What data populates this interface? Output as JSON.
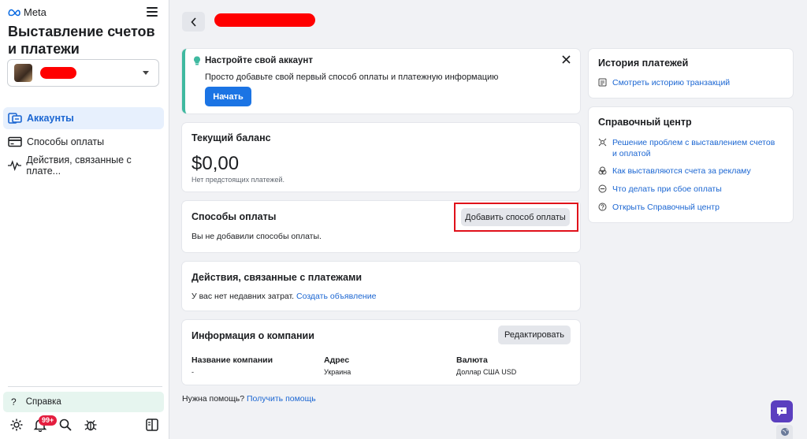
{
  "brand": {
    "name": "Meta"
  },
  "sidebar": {
    "title": "Выставление счетов и платежи",
    "nav": [
      {
        "label": "Аккаунты",
        "icon": "accounts-icon",
        "active": true
      },
      {
        "label": "Способы оплаты",
        "icon": "credit-card-icon",
        "active": false
      },
      {
        "label": "Действия, связанные с плате...",
        "icon": "activity-pulse-icon",
        "active": false
      }
    ],
    "help_label": "Справка",
    "notifications_badge": "99+"
  },
  "setup_banner": {
    "title": "Настройте свой аккаунт",
    "description": "Просто добавьте свой первый способ оплаты и платежную информацию",
    "button_label": "Начать"
  },
  "balance": {
    "title": "Текущий баланс",
    "amount": "$0,00",
    "note": "Нет предстоящих платежей."
  },
  "payment_methods": {
    "title": "Способы оплаты",
    "add_button_label": "Добавить способ оплаты",
    "empty_text": "Вы не добавили способы оплаты."
  },
  "payment_activity": {
    "title": "Действия, связанные с платежами",
    "text": "У вас нет недавних затрат.",
    "link": "Создать объявление"
  },
  "company": {
    "title": "Информация о компании",
    "edit_label": "Редактировать",
    "fields": [
      {
        "label": "Название компании",
        "value": "-"
      },
      {
        "label": "Адрес",
        "value": "Украина"
      },
      {
        "label": "Валюта",
        "value": "Доллар США USD"
      }
    ]
  },
  "footer": {
    "help_text": "Нужна помощь?",
    "help_link": "Получить помощь"
  },
  "payment_history": {
    "title": "История платежей",
    "link": "Смотреть историю транзакций"
  },
  "help_center": {
    "title": "Справочный центр",
    "links": [
      {
        "label": "Решение проблем с выставлением счетов и оплатой",
        "icon": "troubleshoot-icon"
      },
      {
        "label": "Как выставляются счета за рекламу",
        "icon": "billing-info-icon"
      },
      {
        "label": "Что делать при сбое оплаты",
        "icon": "failed-payment-icon"
      },
      {
        "label": "Открыть Справочный центр",
        "icon": "question-icon"
      }
    ]
  },
  "colors": {
    "accent": "#1b74e4",
    "link": "#1b66d2",
    "highlight_frame": "#e0101a",
    "banner_stripe": "#3fb9a0"
  }
}
